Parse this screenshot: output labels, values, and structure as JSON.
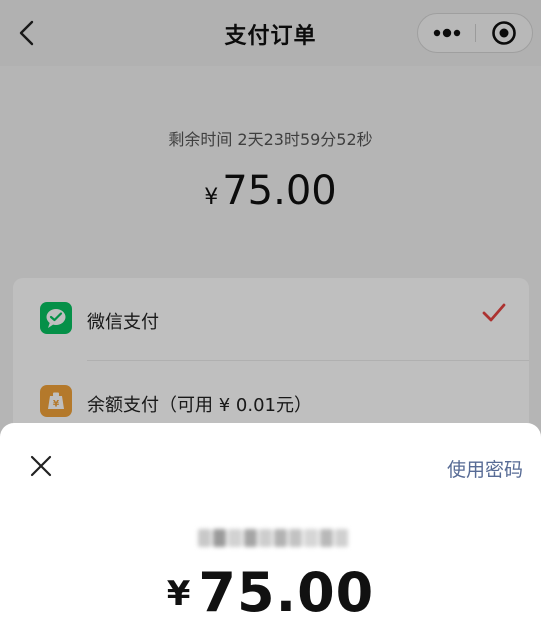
{
  "nav": {
    "title": "支付订单"
  },
  "order": {
    "remaining": "剩余时间 2天23时59分52秒",
    "currency": "¥",
    "amount": "75.00"
  },
  "methods": [
    {
      "label": "微信支付",
      "icon": "wechat-pay-icon",
      "color": "#07c160",
      "selected": true
    },
    {
      "label": "余额支付（可用 ¥ 0.01元）",
      "icon": "wallet-icon",
      "color": "#f0a23a",
      "selected": false
    }
  ],
  "sheet": {
    "use_password": "使用密码",
    "currency": "¥",
    "amount": "75.00"
  },
  "colors": {
    "accent_link": "#576b95",
    "check": "#e64340"
  }
}
